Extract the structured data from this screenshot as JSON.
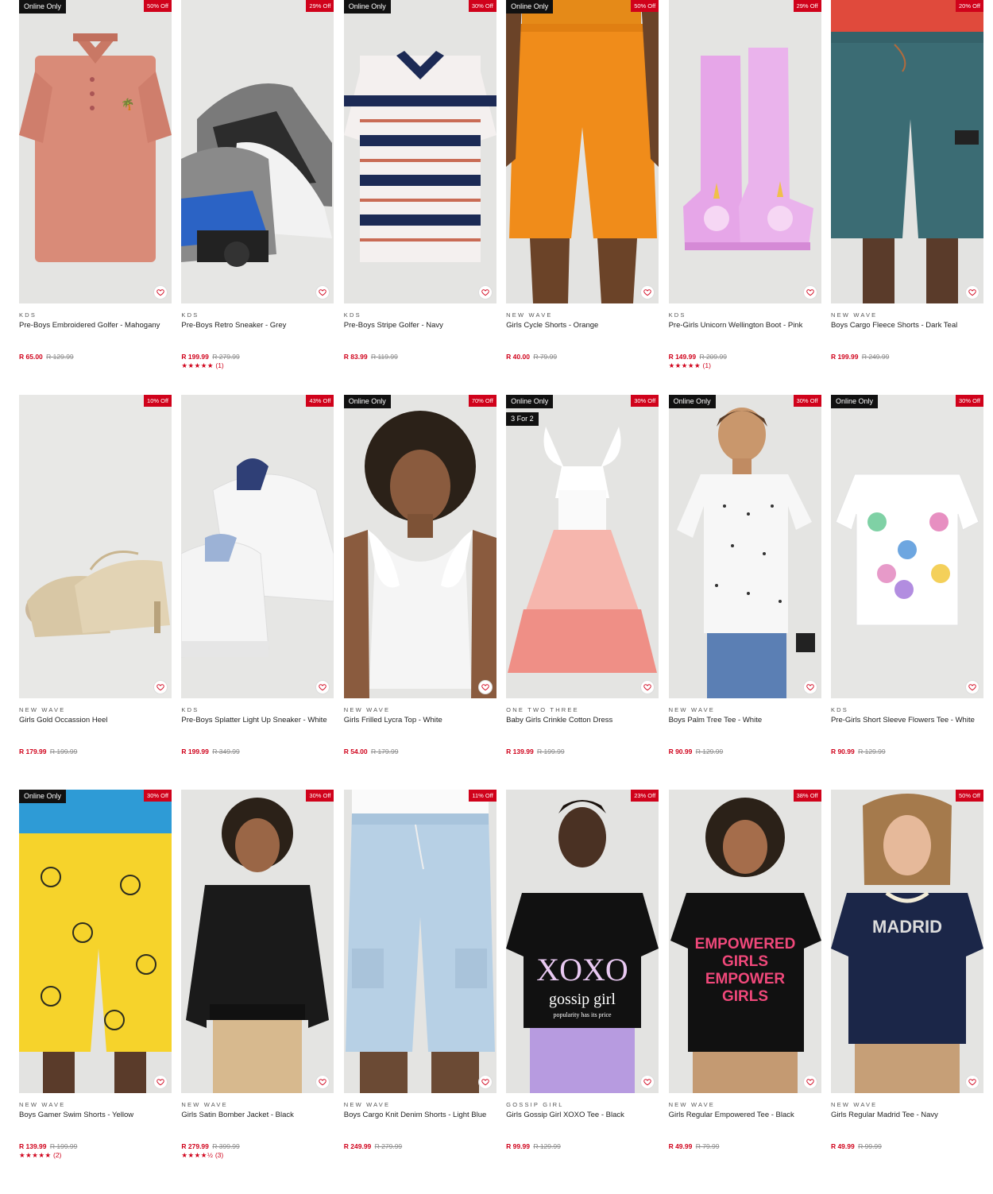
{
  "colors": {
    "accent": "#d0021b",
    "tag_bg": "#111111"
  },
  "products": [
    {
      "brand": "KDS",
      "name": "Pre-Boys Embroidered Golfer - Mahogany",
      "price": "R 65.00",
      "was": "R 129.99",
      "off": "50% Off",
      "online": "Online Only",
      "promo": "",
      "rating": "",
      "stars": "",
      "bg": "#e4e4e2",
      "art": "golfer-pink"
    },
    {
      "brand": "KDS",
      "name": "Pre-Boys Retro Sneaker - Grey",
      "price": "R 199.99",
      "was": "R 279.99",
      "off": "29% Off",
      "online": "",
      "promo": "",
      "rating": "(1)",
      "stars": "★★★★★",
      "bg": "#e6e6e4",
      "art": "sneaker-grey"
    },
    {
      "brand": "KDS",
      "name": "Pre-Boys Stripe Golfer - Navy",
      "price": "R 83.99",
      "was": "R 119.99",
      "off": "30% Off",
      "online": "Online Only",
      "promo": "",
      "rating": "",
      "stars": "",
      "bg": "#e4e4e2",
      "art": "golfer-stripe"
    },
    {
      "brand": "NEW WAVE",
      "name": "Girls Cycle Shorts - Orange",
      "price": "R 40.00",
      "was": "R 79.99",
      "off": "50% Off",
      "online": "Online Only",
      "promo": "",
      "rating": "",
      "stars": "",
      "bg": "#e3e3e1",
      "art": "shorts-orange"
    },
    {
      "brand": "KDS",
      "name": "Pre-Girls Unicorn Wellington Boot - Pink",
      "price": "R 149.99",
      "was": "R 209.99",
      "off": "29% Off",
      "online": "",
      "promo": "",
      "rating": "(1)",
      "stars": "★★★★★",
      "bg": "#e4e4e2",
      "art": "boots-pink"
    },
    {
      "brand": "NEW WAVE",
      "name": "Boys Cargo Fleece Shorts - Dark Teal",
      "price": "R 199.99",
      "was": "R 249.99",
      "off": "20% Off",
      "online": "",
      "promo": "",
      "rating": "",
      "stars": "",
      "bg": "#e3e3e1",
      "art": "shorts-teal"
    },
    {
      "brand": "NEW WAVE",
      "name": "Girls Gold Occassion Heel",
      "price": "R 179.99",
      "was": "R 199.99",
      "off": "10% Off",
      "online": "",
      "promo": "",
      "rating": "",
      "stars": "",
      "bg": "#e8e8e6",
      "art": "heels-gold"
    },
    {
      "brand": "KDS",
      "name": "Pre-Boys Splatter Light Up Sneaker - White",
      "price": "R 199.99",
      "was": "R 349.99",
      "off": "43% Off",
      "online": "",
      "promo": "",
      "rating": "",
      "stars": "",
      "bg": "#e6e6e4",
      "art": "sneaker-white"
    },
    {
      "brand": "NEW WAVE",
      "name": "Girls Frilled Lycra Top - White",
      "price": "R 54.00",
      "was": "R 179.99",
      "off": "70% Off",
      "online": "Online Only",
      "promo": "",
      "rating": "",
      "stars": "",
      "bg": "#e5e5e3",
      "art": "top-white"
    },
    {
      "brand": "ONE TWO THREE",
      "name": "Baby Girls Crinkle Cotton Dress",
      "price": "R 139.99",
      "was": "R 199.99",
      "off": "30% Off",
      "online": "Online Only",
      "promo": "3 For 2",
      "rating": "",
      "stars": "",
      "bg": "#e4e4e2",
      "art": "dress-pink"
    },
    {
      "brand": "NEW WAVE",
      "name": "Boys Palm Tree Tee - White",
      "price": "R 90.99",
      "was": "R 129.99",
      "off": "30% Off",
      "online": "Online Only",
      "promo": "",
      "rating": "",
      "stars": "",
      "bg": "#e4e4e2",
      "art": "tee-palm"
    },
    {
      "brand": "KDS",
      "name": "Pre-Girls Short Sleeve Flowers Tee - White",
      "price": "R 90.99",
      "was": "R 129.99",
      "off": "30% Off",
      "online": "Online Only",
      "promo": "",
      "rating": "",
      "stars": "",
      "bg": "#e6e6e4",
      "art": "tee-flowers"
    },
    {
      "brand": "NEW WAVE",
      "name": "Boys Gamer Swim Shorts - Yellow",
      "price": "R 139.99",
      "was": "R 199.99",
      "off": "30% Off",
      "online": "Online Only",
      "promo": "",
      "rating": "(2)",
      "stars": "★★★★★",
      "bg": "#e3e3e1",
      "art": "swim-yellow"
    },
    {
      "brand": "NEW WAVE",
      "name": "Girls Satin Bomber Jacket - Black",
      "price": "R 279.99",
      "was": "R 399.99",
      "off": "30% Off",
      "online": "",
      "promo": "",
      "rating": "(3)",
      "stars": "★★★★½",
      "bg": "#e4e4e2",
      "art": "bomber-black"
    },
    {
      "brand": "NEW WAVE",
      "name": "Boys Cargo Knit Denim Shorts - Light Blue",
      "price": "R 249.99",
      "was": "R 279.99",
      "off": "11% Off",
      "online": "",
      "promo": "",
      "rating": "",
      "stars": "",
      "bg": "#e4e4e2",
      "art": "denim-shorts"
    },
    {
      "brand": "GOSSIP GIRL",
      "name": "Girls Gossip Girl XOXO Tee - Black",
      "price": "R 99.99",
      "was": "R 129.99",
      "off": "23% Off",
      "online": "",
      "promo": "",
      "rating": "",
      "stars": "",
      "bg": "#e3e3e1",
      "art": "tee-xoxo"
    },
    {
      "brand": "NEW WAVE",
      "name": "Girls Regular Empowered Tee - Black",
      "price": "R 49.99",
      "was": "R 79.99",
      "off": "38% Off",
      "online": "",
      "promo": "",
      "rating": "",
      "stars": "",
      "bg": "#e4e4e2",
      "art": "tee-empower"
    },
    {
      "brand": "NEW WAVE",
      "name": "Girls Regular Madrid Tee - Navy",
      "price": "R 49.99",
      "was": "R 99.99",
      "off": "50% Off",
      "online": "",
      "promo": "",
      "rating": "",
      "stars": "",
      "bg": "#e4e4e2",
      "art": "tee-madrid"
    }
  ],
  "graphics": {
    "xoxo": "XOXO",
    "gossip": "gossip girl",
    "popularity": "popularity has its price",
    "empowered": [
      "EMPOWERED",
      "GIRLS",
      "EMPOWER",
      "GIRLS"
    ],
    "madrid": "MADRID"
  }
}
